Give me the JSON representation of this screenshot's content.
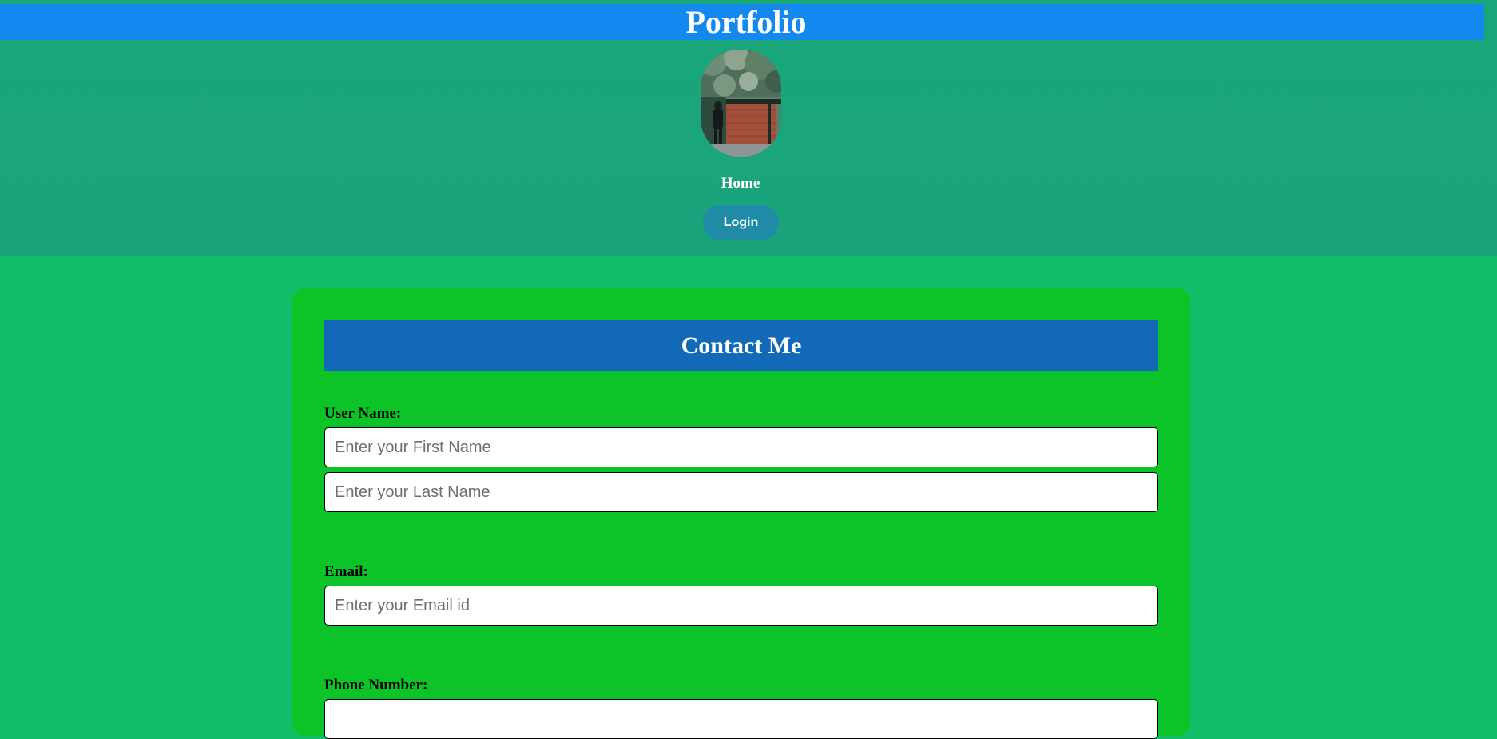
{
  "header": {
    "title": "Portfolio",
    "avatar_icon": "profile-photo",
    "nav_home": "Home",
    "login_label": "Login"
  },
  "contact": {
    "heading": "Contact Me",
    "user_name_label": "User Name:",
    "first_name_placeholder": "Enter your First Name",
    "last_name_placeholder": "Enter your Last Name",
    "email_label": "Email:",
    "email_placeholder": "Enter your Email id",
    "phone_label": "Phone Number:"
  },
  "colors": {
    "page_background": "#14bd69",
    "header_background": "#19a67a",
    "title_bar": "#1388ef",
    "login_button": "#1f8ba6",
    "card_background": "#0dc428",
    "card_header": "#1169b7"
  }
}
